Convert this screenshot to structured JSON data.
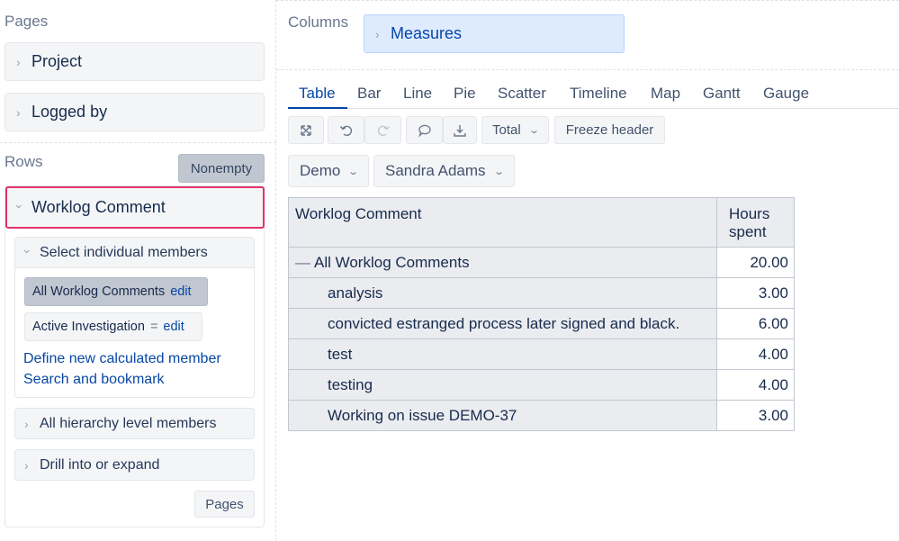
{
  "left_panel": {
    "pages_label": "Pages",
    "pages_items": [
      "Project",
      "Logged by"
    ],
    "rows_label": "Rows",
    "nonempty_label": "Nonempty",
    "dimension_title": "Worklog Comment",
    "select_members_label": "Select individual members",
    "members": [
      {
        "label": "All Worklog Comments",
        "action": "edit",
        "selected": true
      },
      {
        "label": "Active Investigation",
        "symbol": "=",
        "action": "edit",
        "selected": false
      }
    ],
    "define_member_link": "Define new calculated member",
    "search_bookmark_link": "Search and bookmark",
    "all_levels_label": "All hierarchy level members",
    "drill_label": "Drill into or expand",
    "pages_button": "Pages"
  },
  "right_panel": {
    "columns_label": "Columns",
    "measures_label": "Measures",
    "tabs": [
      "Table",
      "Bar",
      "Line",
      "Pie",
      "Scatter",
      "Timeline",
      "Map",
      "Gantt",
      "Gauge"
    ],
    "active_tab": "Table",
    "toolbar": {
      "total_label": "Total",
      "freeze_label": "Freeze header"
    },
    "filters": [
      "Demo",
      "Sandra Adams"
    ],
    "table": {
      "header_row": "Worklog Comment",
      "header_measure": "Hours spent",
      "rows": [
        {
          "label": "All Worklog Comments",
          "value": "20.00"
        },
        {
          "label": "analysis",
          "value": "3.00"
        },
        {
          "label": "convicted estranged process later signed and black.",
          "value": "6.00"
        },
        {
          "label": "test",
          "value": "4.00"
        },
        {
          "label": "testing",
          "value": "4.00"
        },
        {
          "label": "Working on issue DEMO-37",
          "value": "3.00"
        }
      ]
    }
  },
  "colors": {
    "highlight_border": "#e2336b",
    "link": "#0747a6",
    "measures_bg": "#deebff"
  }
}
